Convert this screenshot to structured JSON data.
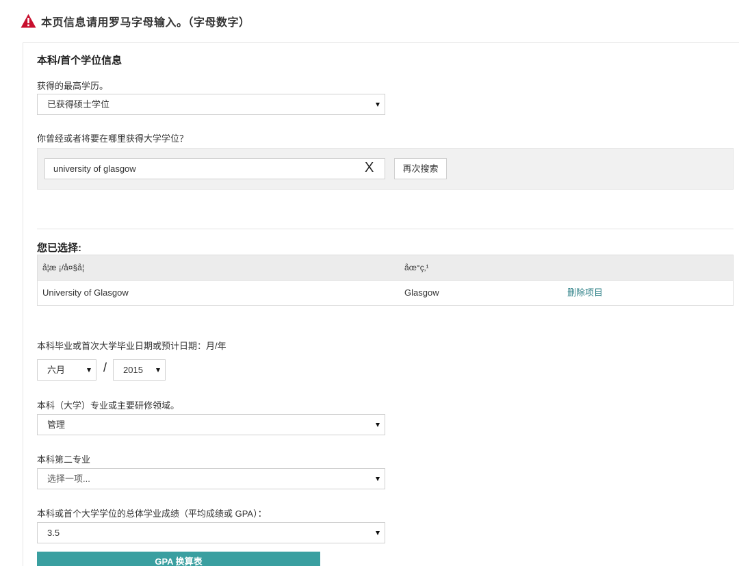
{
  "warning": {
    "icon": "warning-triangle-icon",
    "text": "本页信息请用罗马字母输入。（字母数字）"
  },
  "section": {
    "title": "本科/首个学位信息"
  },
  "highest_degree": {
    "label": "获得的最高学历。",
    "value": "已获得硕士学位"
  },
  "university_search": {
    "label": "你曾经或者将要在哪里获得大学学位？",
    "input_value": "university of glasgow",
    "clear_label": "X",
    "search_again_label": "再次搜索"
  },
  "selected": {
    "title": "您已选择:",
    "columns": [
      "å¦æ ¡/å¤§å¦",
      "åœ°ç‚¹"
    ],
    "rows": [
      {
        "school": "University of Glasgow",
        "location": "Glasgow",
        "delete_label": "删除项目"
      }
    ]
  },
  "graduation_date": {
    "label": "本科毕业或首次大学毕业日期或预计日期：月/年",
    "month": "六月",
    "separator": "/",
    "year": "2015"
  },
  "major": {
    "label": "本科（大学）专业或主要研修领域。",
    "value": "管理"
  },
  "second_major": {
    "label": "本科第二专业",
    "value": "选择一项..."
  },
  "gpa": {
    "label": "本科或首个大学学位的总体学业成绩（平均成绩或 GPA）：",
    "value": "3.5",
    "converter_label": "GPA 换算表"
  },
  "colors": {
    "warning": "#c8102e",
    "accent": "#3a9fa0",
    "link": "#2c7f86"
  }
}
